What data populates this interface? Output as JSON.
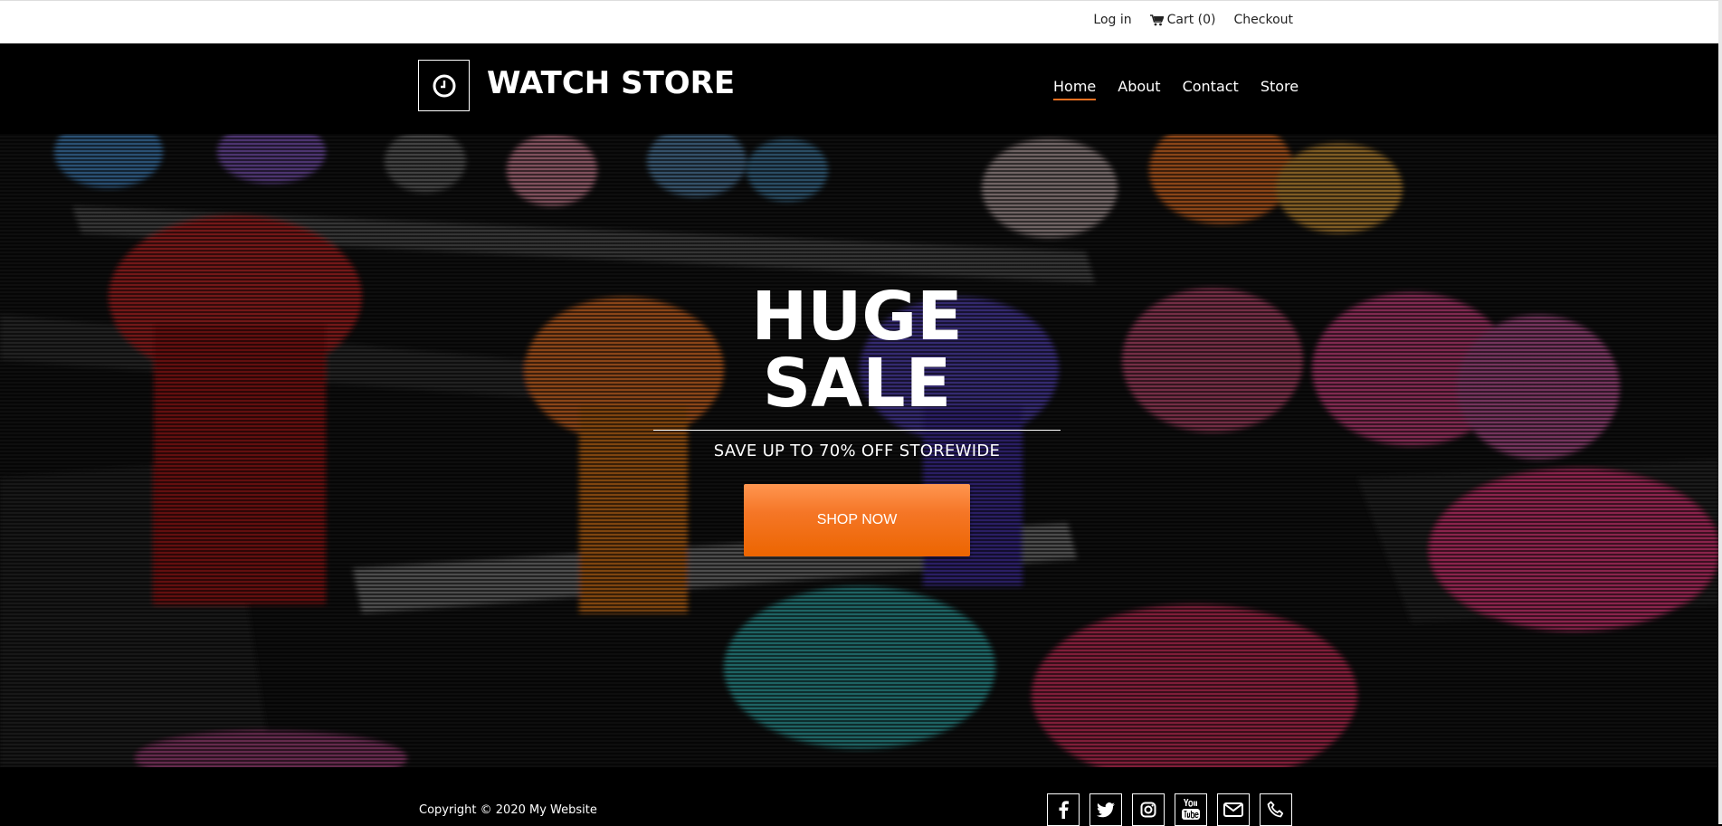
{
  "topbar": {
    "login": "Log in",
    "cart": "Cart (0)",
    "checkout": "Checkout"
  },
  "header": {
    "site_title": "WATCH STORE",
    "nav": [
      {
        "label": "Home",
        "active": true
      },
      {
        "label": "About",
        "active": false
      },
      {
        "label": "Contact",
        "active": false
      },
      {
        "label": "Store",
        "active": false
      }
    ]
  },
  "hero": {
    "title": "HUGE SALE",
    "subtitle": "SAVE UP TO 70% OFF STOREWIDE",
    "button": "SHOP NOW"
  },
  "footer": {
    "copyright": "Copyright © 2020 My Website",
    "socials": [
      "facebook-icon",
      "twitter-icon",
      "instagram-icon",
      "youtube-icon",
      "email-icon",
      "phone-icon"
    ]
  },
  "colors": {
    "accent": "#f07020",
    "button_top": "#ff9650",
    "button_bottom": "#ec6500",
    "header_bg": "#000000"
  }
}
